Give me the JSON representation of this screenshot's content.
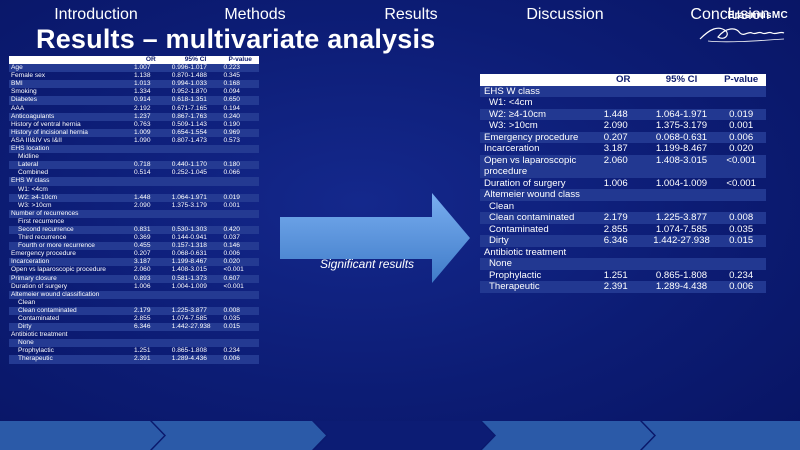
{
  "title": "Results – multivariate analysis",
  "logo": {
    "brand": "ErasmusMC",
    "script": "Erasmus",
    "icon": "erasmus-logo-icon"
  },
  "left_table": {
    "headers": [
      "",
      "OR",
      "95% CI",
      "P-value"
    ],
    "rows": [
      {
        "label": "Age",
        "or": "1.007",
        "ci": "0.996-1.017",
        "p": "0.223",
        "style": "hl"
      },
      {
        "label": "Female sex",
        "or": "1.138",
        "ci": "0.870-1.488",
        "p": "0.345",
        "style": ""
      },
      {
        "label": "BMI",
        "or": "1.013",
        "ci": "0.994-1.033",
        "p": "0.168",
        "style": "hl"
      },
      {
        "label": "Smoking",
        "or": "1.334",
        "ci": "0.952-1.870",
        "p": "0.094",
        "style": ""
      },
      {
        "label": "Diabetes",
        "or": "0.914",
        "ci": "0.618-1.351",
        "p": "0.650",
        "style": "hl"
      },
      {
        "label": "AAA",
        "or": "2.192",
        "ci": "0.671-7.165",
        "p": "0.194",
        "style": ""
      },
      {
        "label": "Anticoagulants",
        "or": "1.237",
        "ci": "0.867-1.763",
        "p": "0.240",
        "style": "hl"
      },
      {
        "label": "History of ventral hernia",
        "or": "0.763",
        "ci": "0.509-1.143",
        "p": "0.190",
        "style": ""
      },
      {
        "label": "History of incisional hernia",
        "or": "1.009",
        "ci": "0.654-1.554",
        "p": "0.969",
        "style": "hl"
      },
      {
        "label": "ASA III&IV vs I&II",
        "or": "1.090",
        "ci": "0.807-1.473",
        "p": "0.573",
        "style": ""
      },
      {
        "label": "EHS location",
        "or": "",
        "ci": "",
        "p": "",
        "style": "hl"
      },
      {
        "label": "Midline",
        "or": "",
        "ci": "",
        "p": "",
        "style": "",
        "indent": true
      },
      {
        "label": "Lateral",
        "or": "0.718",
        "ci": "0.440-1.170",
        "p": "0.180",
        "style": "hl",
        "indent": true
      },
      {
        "label": "Combined",
        "or": "0.514",
        "ci": "0.252-1.045",
        "p": "0.066",
        "style": "",
        "indent": true
      },
      {
        "label": "EHS W class",
        "or": "",
        "ci": "",
        "p": "",
        "style": "hl"
      },
      {
        "label": "",
        "or": "",
        "ci": "",
        "p": "",
        "style": "hl"
      },
      {
        "label": "W1: <4cm",
        "or": "",
        "ci": "",
        "p": "",
        "style": "",
        "indent": true
      },
      {
        "label": "W2: ≥4-10cm",
        "or": "1.448",
        "ci": "1.064-1.971",
        "p": "0.019",
        "style": "hl",
        "indent": true
      },
      {
        "label": "W3: >10cm",
        "or": "2.090",
        "ci": "1.375-3.179",
        "p": "0.001",
        "style": "",
        "indent": true
      },
      {
        "label": "Number of recurrences",
        "or": "",
        "ci": "",
        "p": "",
        "style": "hl"
      },
      {
        "label": "First recurrence",
        "or": "",
        "ci": "",
        "p": "",
        "style": "",
        "indent": true
      },
      {
        "label": "Second recurrence",
        "or": "0.831",
        "ci": "0.530-1.303",
        "p": "0.420",
        "style": "hl",
        "indent": true
      },
      {
        "label": "Third recurrence",
        "or": "0.369",
        "ci": "0.144-0.941",
        "p": "0.037",
        "style": "",
        "indent": true
      },
      {
        "label": "Fourth or more recurrence",
        "or": "0.455",
        "ci": "0.157-1.318",
        "p": "0.146",
        "style": "hl",
        "indent": true
      },
      {
        "label": "Emergency procedure",
        "or": "0.207",
        "ci": "0.068-0.631",
        "p": "0.006",
        "style": ""
      },
      {
        "label": "Incarceration",
        "or": "3.187",
        "ci": "1.199-8.467",
        "p": "0.020",
        "style": "hl"
      },
      {
        "label": "Open vs laparoscopic procedure",
        "or": "2.060",
        "ci": "1.408-3.015",
        "p": "<0.001",
        "style": ""
      },
      {
        "label": "Primary closure",
        "or": "0.893",
        "ci": "0.581-1.373",
        "p": "0.607",
        "style": "hl"
      },
      {
        "label": "Duration of surgery",
        "or": "1.006",
        "ci": "1.004-1.009",
        "p": "<0.001",
        "style": ""
      },
      {
        "label": "Altemeier wound classification",
        "or": "",
        "ci": "",
        "p": "",
        "style": "hl"
      },
      {
        "label": "Clean",
        "or": "",
        "ci": "",
        "p": "",
        "style": "",
        "indent": true
      },
      {
        "label": "Clean contaminated",
        "or": "2.179",
        "ci": "1.225-3.877",
        "p": "0.008",
        "style": "hl",
        "indent": true
      },
      {
        "label": "Contaminated",
        "or": "2.855",
        "ci": "1.074-7.585",
        "p": "0.035",
        "style": "",
        "indent": true
      },
      {
        "label": "Dirty",
        "or": "6.346",
        "ci": "1.442-27.938",
        "p": "0.015",
        "style": "hl",
        "indent": true
      },
      {
        "label": "Antibiotic treatment",
        "or": "",
        "ci": "",
        "p": "",
        "style": ""
      },
      {
        "label": "None",
        "or": "",
        "ci": "",
        "p": "",
        "style": "hl",
        "indent": true
      },
      {
        "label": "Prophylactic",
        "or": "1.251",
        "ci": "0.865-1.808",
        "p": "0.234",
        "style": "",
        "indent": true
      },
      {
        "label": "Therapeutic",
        "or": "2.391",
        "ci": "1.289-4.436",
        "p": "0.006",
        "style": "hl",
        "indent": true
      }
    ]
  },
  "right_table": {
    "headers": [
      "",
      "OR",
      "95% CI",
      "P-value"
    ],
    "rows": [
      {
        "label": "EHS W class",
        "or": "",
        "ci": "",
        "p": "",
        "style": "hl"
      },
      {
        "label": "",
        "or": "",
        "ci": "",
        "p": "",
        "style": "hl"
      },
      {
        "label": "W1: <4cm",
        "or": "",
        "ci": "",
        "p": "",
        "style": "",
        "indent": true
      },
      {
        "label": "W2: ≥4-10cm",
        "or": "1.448",
        "ci": "1.064-1.971",
        "p": "0.019",
        "style": "hl",
        "indent": true
      },
      {
        "label": "W3: >10cm",
        "or": "2.090",
        "ci": "1.375-3.179",
        "p": "0.001",
        "style": "",
        "indent": true
      },
      {
        "label": "Emergency procedure",
        "or": "0.207",
        "ci": "0.068-0.631",
        "p": "0.006",
        "style": "hl"
      },
      {
        "label": "Incarceration",
        "or": "3.187",
        "ci": "1.199-8.467",
        "p": "0.020",
        "style": ""
      },
      {
        "label": "Open vs laparoscopic procedure",
        "or": "2.060",
        "ci": "1.408-3.015",
        "p": "<0.001",
        "style": "hl"
      },
      {
        "label": "Duration of surgery",
        "or": "1.006",
        "ci": "1.004-1.009",
        "p": "<0.001",
        "style": ""
      },
      {
        "label": "Altemeier wound class",
        "or": "",
        "ci": "",
        "p": "",
        "style": "hl"
      },
      {
        "label": "Clean",
        "or": "",
        "ci": "",
        "p": "",
        "style": "",
        "indent": true
      },
      {
        "label": "Clean contaminated",
        "or": "2.179",
        "ci": "1.225-3.877",
        "p": "0.008",
        "style": "hl",
        "indent": true
      },
      {
        "label": "Contaminated",
        "or": "2.855",
        "ci": "1.074-7.585",
        "p": "0.035",
        "style": "",
        "indent": true
      },
      {
        "label": "Dirty",
        "or": "6.346",
        "ci": "1.442-27.938",
        "p": "0.015",
        "style": "hl",
        "indent": true
      },
      {
        "label": "Antibiotic treatment",
        "or": "",
        "ci": "",
        "p": "",
        "style": ""
      },
      {
        "label": "None",
        "or": "",
        "ci": "",
        "p": "",
        "style": "hl",
        "indent": true
      },
      {
        "label": "Prophylactic",
        "or": "1.251",
        "ci": "0.865-1.808",
        "p": "0.234",
        "style": "",
        "indent": true
      },
      {
        "label": "Therapeutic",
        "or": "2.391",
        "ci": "1.289-4.438",
        "p": "0.006",
        "style": "hl",
        "indent": true
      }
    ]
  },
  "arrow_label": "Significant results",
  "nav": {
    "items": [
      {
        "label": "Introduction",
        "active": false
      },
      {
        "label": "Methods",
        "active": false
      },
      {
        "label": "Results",
        "active": true
      },
      {
        "label": "Discussion",
        "active": false
      },
      {
        "label": "Conclusion",
        "active": false
      }
    ]
  },
  "colors": {
    "background": "#0b1a6e",
    "row_highlight": "#223891",
    "nav_inactive": "#2b5aa8",
    "nav_active": "#0c1c74",
    "arrow": "#5b93d6"
  }
}
